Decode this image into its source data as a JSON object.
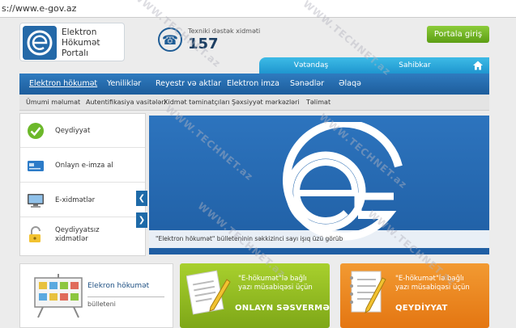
{
  "browser": {
    "url": "s://www.e-gov.az"
  },
  "header": {
    "logo_lines": [
      "Elektron",
      "Hökumət",
      "Portalı"
    ],
    "support_label": "Texniki dəstək xidməti",
    "support_number": "157",
    "portal_button": "Portala giriş"
  },
  "audience_tabs": [
    "Vətəndaş",
    "Sahibkar"
  ],
  "nav": {
    "items": [
      "Elektron hökumət",
      "Yeniliklər",
      "Reyestr və aktlar",
      "Elektron imza",
      "Sənədlər",
      "Əlaqə"
    ]
  },
  "subnav": {
    "items": [
      "Ümumi məlumat",
      "Autentifikasiya vasitələri",
      "Xidmət təminatçıları",
      "Şəxsiyyət mərkəzləri",
      "Təlimat"
    ]
  },
  "left_panel": {
    "items": [
      {
        "label_lines": [
          "Qeydiyyat"
        ],
        "icon": "checkmark-icon"
      },
      {
        "label_lines": [
          "Onlayn e-imza al"
        ],
        "icon": "card-icon"
      },
      {
        "label_lines": [
          "E-xidmətlər"
        ],
        "icon": "monitor-icon"
      },
      {
        "label_lines": [
          "Qeydiyyatsız",
          "xidmətlər"
        ],
        "icon": "padlock-icon"
      }
    ]
  },
  "banner": {
    "caption": "\"Elektron hökumət\" bülleteninin səkkizinci sayı işıq üzü görüb"
  },
  "cards": {
    "bulletin": {
      "title": "Elekron hökumət",
      "subtitle": "bülleteni"
    },
    "vote": {
      "text_lines": [
        "\"E-hökumət\"lə bağlı",
        "yazı müsabiqəsi üçün"
      ],
      "cta": "ONLAYN SƏSVERMƏ"
    },
    "register": {
      "text_lines": [
        "\"E-hökumət\"lə bağlı",
        "yazı müsabiqəsi üçün"
      ],
      "cta": "QEYDİYYAT"
    }
  },
  "watermark": "WWW.TECHNET.az",
  "colors": {
    "nav_blue": "#1d5d9c",
    "green": "#7ea718",
    "orange": "#e47612",
    "tab_cyan": "#1f96cf"
  }
}
